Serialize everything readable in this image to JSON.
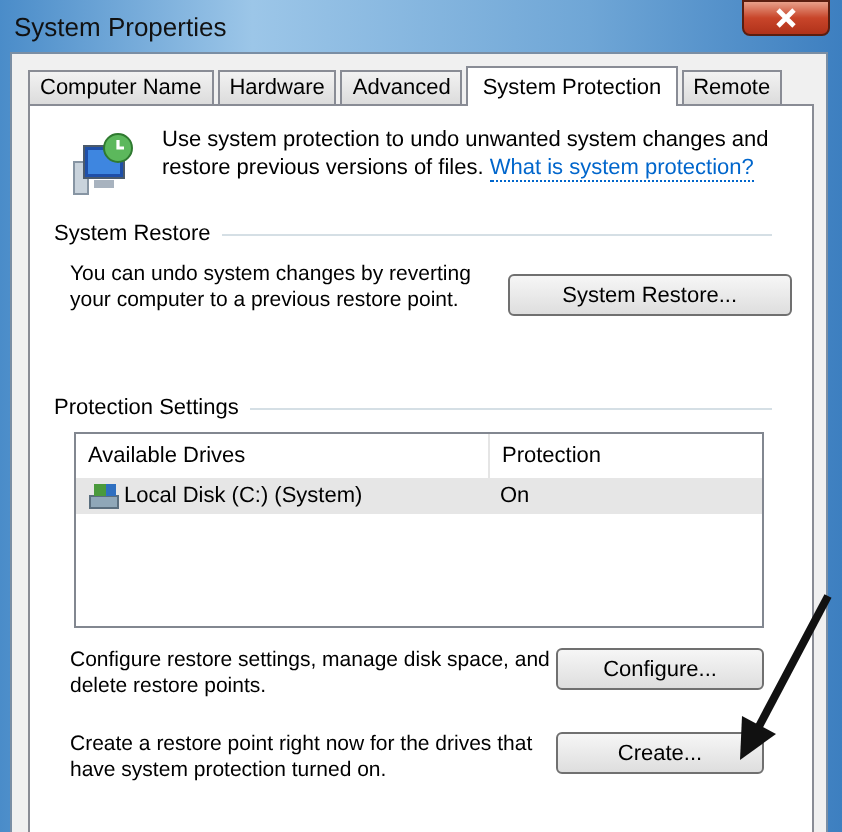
{
  "window": {
    "title": "System Properties"
  },
  "tabs": [
    {
      "label": "Computer Name",
      "selected": false
    },
    {
      "label": "Hardware",
      "selected": false
    },
    {
      "label": "Advanced",
      "selected": false
    },
    {
      "label": "System Protection",
      "selected": true
    },
    {
      "label": "Remote",
      "selected": false
    }
  ],
  "intro": {
    "text": "Use system protection to undo unwanted system changes and restore previous versions of files.",
    "link": "What is system protection?"
  },
  "system_restore": {
    "heading": "System Restore",
    "text": "You can undo system changes by reverting your computer to a previous restore point.",
    "button": "System Restore..."
  },
  "protection_settings": {
    "heading": "Protection Settings",
    "columns": [
      "Available Drives",
      "Protection"
    ],
    "rows": [
      {
        "drive": "Local Disk (C:) (System)",
        "protection": "On",
        "selected": true
      }
    ],
    "actions": [
      {
        "text": "Configure restore settings, manage disk space, and delete restore points.",
        "button": "Configure..."
      },
      {
        "text": "Create a restore point right now for the drives that have system protection turned on.",
        "button": "Create..."
      }
    ]
  }
}
